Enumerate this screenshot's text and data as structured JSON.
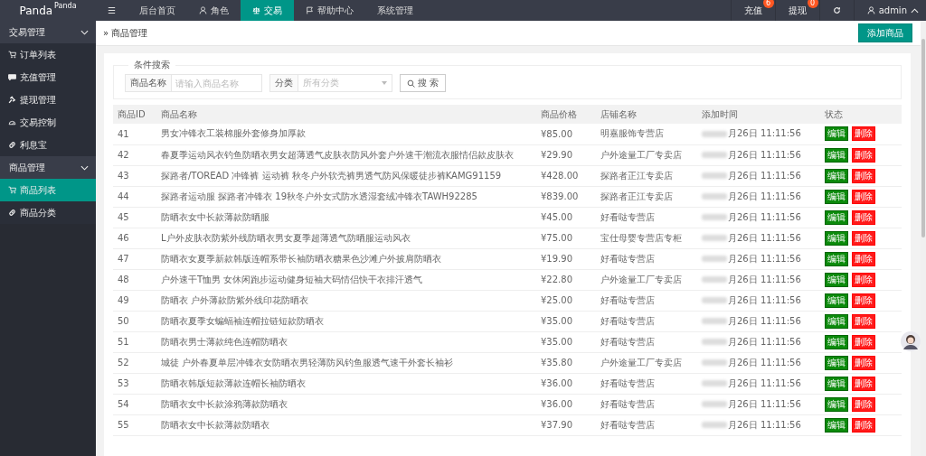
{
  "logo": {
    "name": "Panda",
    "sup": "Panda"
  },
  "top_nav": [
    {
      "label": "☰",
      "selected": false
    },
    {
      "label": "后台首页",
      "selected": false
    },
    {
      "label": "角色",
      "selected": false
    },
    {
      "label": "交易",
      "selected": true
    },
    {
      "label": "帮助中心",
      "selected": false
    },
    {
      "label": "系统管理",
      "selected": false
    }
  ],
  "top_right": [
    {
      "kind": "badge",
      "label": "充值",
      "badge": "6"
    },
    {
      "kind": "badge",
      "label": "提现",
      "badge": "0"
    },
    {
      "kind": "refresh"
    },
    {
      "kind": "user",
      "label": "admin"
    }
  ],
  "sidebar": [
    {
      "label": "交易管理",
      "expanded": true,
      "children": [
        {
          "label": "订单列表",
          "selected": false
        },
        {
          "label": "充值管理",
          "selected": false
        },
        {
          "label": "提现管理",
          "selected": false
        },
        {
          "label": "交易控制",
          "selected": false
        },
        {
          "label": "利息宝",
          "selected": false
        }
      ]
    },
    {
      "label": "商品管理",
      "expanded": true,
      "children": [
        {
          "label": "商品列表",
          "selected": true
        },
        {
          "label": "商品分类",
          "selected": false
        }
      ]
    }
  ],
  "breadcrumb": {
    "separator": "»",
    "label": "商品管理"
  },
  "add_button": "添加商品",
  "search": {
    "legend": "条件搜索",
    "name_label": "商品名称",
    "name_placeholder": "请输入商品名称",
    "category_label": "分类",
    "category_placeholder": "所有分类",
    "button": "搜 索"
  },
  "table": {
    "columns": [
      "商品ID",
      "商品名称",
      "商品价格",
      "店铺名称",
      "添加时间",
      "状态"
    ],
    "rows": [
      {
        "id": "41",
        "name": "男女冲锋衣工装棉服外套修身加厚款",
        "price": "¥85.00",
        "shop": "明嘉服饰专营店",
        "time": "月26日 11:11:56",
        "edit": "编辑",
        "delete": "删除"
      },
      {
        "id": "42",
        "name": "春夏季运动风衣钓鱼防晒衣男女超薄透气皮肤衣防风外套户外速干潮流衣服情侣款皮肤衣",
        "price": "¥29.90",
        "shop": "户外途量工厂专卖店",
        "time": "月26日 11:11:56",
        "edit": "编辑",
        "delete": "删除"
      },
      {
        "id": "43",
        "name": "探路者/TOREAD 冲锋裤 运动裤 秋冬户外软壳裤男透气防风保暖徒步裤KAMG91159",
        "price": "¥428.00",
        "shop": "探路者正江专卖店",
        "time": "月26日 11:11:56",
        "edit": "编辑",
        "delete": "删除"
      },
      {
        "id": "44",
        "name": "探路者运动服 探路者冲锋衣 19秋冬户外女式防水透湿套绒冲锋衣TAWH92285",
        "price": "¥839.00",
        "shop": "探路者正江专卖店",
        "time": "月26日 11:11:56",
        "edit": "编辑",
        "delete": "删除"
      },
      {
        "id": "45",
        "name": "防晒衣女中长款薄款防晒服",
        "price": "¥45.00",
        "shop": "好看哒专营店",
        "time": "月26日 11:11:56",
        "edit": "编辑",
        "delete": "删除"
      },
      {
        "id": "46",
        "name": "L户外皮肤衣防紫外线防晒衣男女夏季超薄透气防晒服运动风衣",
        "price": "¥75.00",
        "shop": "宝仕母婴专营店专柜",
        "time": "月26日 11:11:56",
        "edit": "编辑",
        "delete": "删除"
      },
      {
        "id": "47",
        "name": "防晒衣女夏季新款韩版连帽系带长袖防晒衣糖果色沙滩户外披肩防晒衣",
        "price": "¥19.90",
        "shop": "好看哒专营店",
        "time": "月26日 11:11:56",
        "edit": "编辑",
        "delete": "删除"
      },
      {
        "id": "48",
        "name": "户外速干T恤男 女休闲跑步运动健身短袖大码情侣快干衣排汗透气",
        "price": "¥22.80",
        "shop": "户外途量工厂专卖店",
        "time": "月26日 11:11:56",
        "edit": "编辑",
        "delete": "删除"
      },
      {
        "id": "49",
        "name": "防晒衣 户外薄款防紫外线印花防晒衣",
        "price": "¥25.00",
        "shop": "好看哒专营店",
        "time": "月26日 11:11:56",
        "edit": "编辑",
        "delete": "删除"
      },
      {
        "id": "50",
        "name": "防晒衣夏季女蝙蝠袖连帽拉链短款防晒衣",
        "price": "¥35.00",
        "shop": "好看哒专营店",
        "time": "月26日 11:11:56",
        "edit": "编辑",
        "delete": "删除"
      },
      {
        "id": "51",
        "name": "防晒衣男士薄款纯色连帽防晒衣",
        "price": "¥35.00",
        "shop": "好看哒专营店",
        "time": "月26日 11:11:56",
        "edit": "编辑",
        "delete": "删除"
      },
      {
        "id": "52",
        "name": "城徒 户外春夏单层冲锋衣女防晒衣男轻薄防风钓鱼服透气速干外套长袖衫",
        "price": "¥35.80",
        "shop": "户外途量工厂专卖店",
        "time": "月26日 11:11:56",
        "edit": "编辑",
        "delete": "删除"
      },
      {
        "id": "53",
        "name": "防晒衣韩版短款薄款连帽长袖防晒衣",
        "price": "¥36.00",
        "shop": "好看哒专营店",
        "time": "月26日 11:11:56",
        "edit": "编辑",
        "delete": "删除"
      },
      {
        "id": "54",
        "name": "防晒衣女中长款涂鸦薄款防晒衣",
        "price": "¥36.00",
        "shop": "好看哒专营店",
        "time": "月26日 11:11:56",
        "edit": "编辑",
        "delete": "删除"
      },
      {
        "id": "55",
        "name": "防晒衣女中长款薄款防晒衣",
        "price": "¥37.90",
        "shop": "好看哒专营店",
        "time": "月26日 11:11:56",
        "edit": "编辑",
        "delete": "删除"
      }
    ]
  }
}
